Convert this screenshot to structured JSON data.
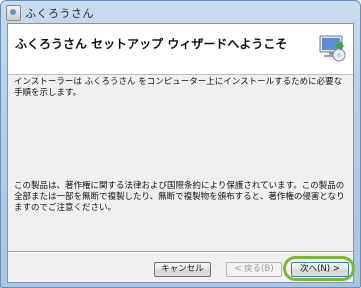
{
  "window": {
    "title": "ふくろうさん",
    "icon": "app-icon"
  },
  "banner": {
    "title": "ふくろうさん セットアップ ウィザードへようこそ",
    "icon": "setup-computer-icon"
  },
  "body": {
    "intro": "インストーラーは ふくろうさん をコンピューター上にインストールするために必要な手順を示します。",
    "copyright_notice": "この製品は、著作権に関する法律および国際条約により保護されています。この製品の全部または一部を無断で複製したり、無断で複製物を頒布すると、著作権の侵害となりますのでご注意ください。"
  },
  "buttons": {
    "cancel": "キャンセル",
    "back": "< 戻る(B)",
    "next": "次へ(N) >"
  },
  "colors": {
    "highlight_ring": "#7fb53a",
    "window_frame": "#b9d1ea"
  }
}
